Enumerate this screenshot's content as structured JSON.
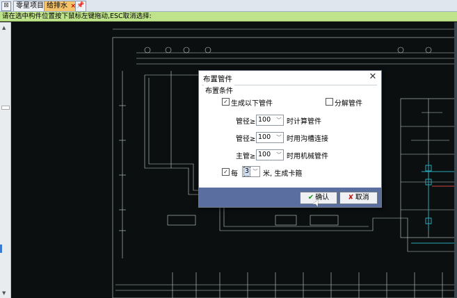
{
  "tabs": {
    "close_all": "⊠",
    "tab1": "零星项目",
    "tab2": "给排水",
    "tab2_close": "×",
    "pin": "📌"
  },
  "status_text": "请在选中构件位置按下鼠标左键拖动,ESC取消选择:",
  "dialog": {
    "title": "布置管件",
    "close": "✕",
    "group_label": "布置条件",
    "gen_pipe_check": "✓",
    "gen_pipe_label": "生成以下管件",
    "split_pipe_label": "分解管件",
    "row1_label": "管径≥",
    "row1_value": "100",
    "row1_suffix": "时计算管件",
    "row2_label": "管径≥",
    "row2_value": "100",
    "row2_suffix": "时用沟槽连接",
    "row3_label": "主管≥",
    "row3_value": "100",
    "row3_suffix": "时用机械管件",
    "every_check": "✓",
    "every_label": "每",
    "every_value": "3",
    "every_suffix": "米, 生成卡箍",
    "ok_icon": "✔",
    "ok_label": "确认",
    "cancel_icon": "✘",
    "cancel_label": "取消"
  },
  "icons": {
    "dropdown": "﹀",
    "arrow_up": "▲",
    "arrow_down": "▼",
    "cursor": "➤"
  },
  "colors": {
    "cad_background": "#0b0f0f",
    "cad_lines": "#c9d3cf",
    "cad_accent": "#2aa7b8",
    "status_bar": "#bfe38a",
    "active_tab": "#f6c36a",
    "dialog_footer": "#5a6fa0"
  }
}
